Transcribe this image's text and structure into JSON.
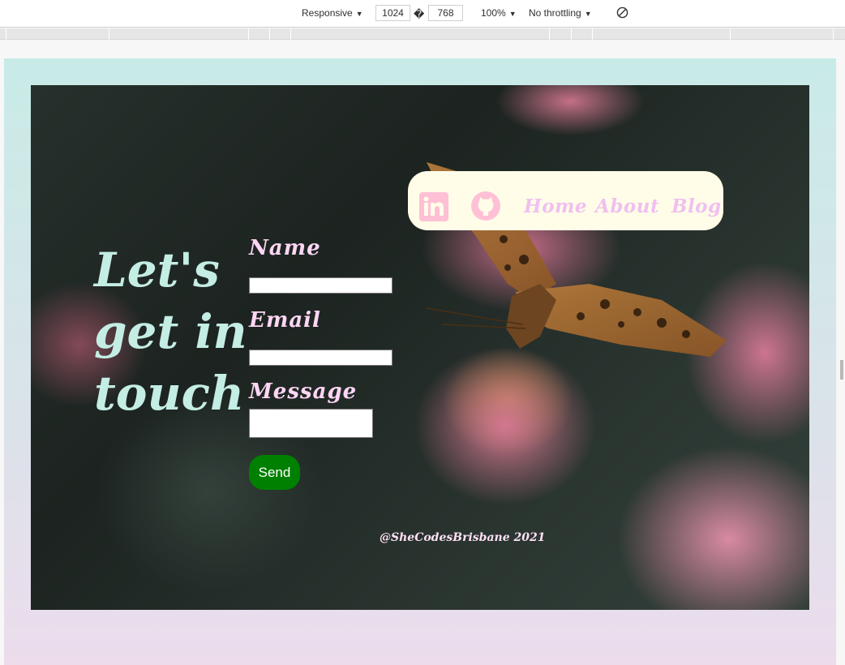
{
  "devtools": {
    "device": "Responsive",
    "width": "1024",
    "separator": "�",
    "height": "768",
    "zoom": "100%",
    "throttling": "No throttling",
    "rotate_icon": "rotate-icon"
  },
  "nav": {
    "linkedin_icon": "linkedin-icon",
    "github_icon": "github-icon",
    "links": [
      "Home",
      "About",
      "Blog"
    ],
    "link_color": "#f0bff0",
    "background": "#fffde8"
  },
  "hero": {
    "heading_lines": [
      "Let's",
      "get in",
      "touch"
    ],
    "heading_color": "#c4ede4"
  },
  "form": {
    "name_label": "Name",
    "email_label": "Email",
    "message_label": "Message",
    "name_value": "",
    "email_value": "",
    "message_value": "",
    "send_label": "Send",
    "send_color": "#008000"
  },
  "footer": {
    "credit": "@SheCodesBrisbane 2021"
  }
}
